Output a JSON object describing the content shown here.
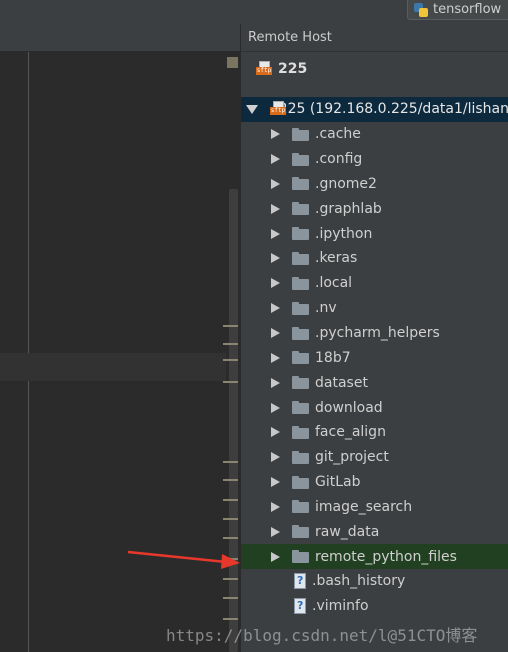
{
  "run_config": {
    "label": "tensorflow",
    "icon": "python-icon"
  },
  "panel": {
    "title": "Remote Host"
  },
  "host_selector": {
    "label": "225",
    "icon": "sftp-icon"
  },
  "tree": {
    "root": {
      "label": "225 (192.168.0.225/data1/lishan",
      "expanded": true
    },
    "folders": [
      ".cache",
      ".config",
      ".gnome2",
      ".graphlab",
      ".ipython",
      ".keras",
      ".local",
      ".nv",
      ".pycharm_helpers",
      "18b7",
      "dataset",
      "download",
      "face_align",
      "git_project",
      "GitLab",
      "image_search",
      "raw_data",
      "remote_python_files"
    ],
    "selected": "remote_python_files",
    "files": [
      ".bash_history",
      ".viminfo"
    ]
  },
  "watermark": "https://blog.csdn.net/l@51CTO博客",
  "colors": {
    "selection": "#214021",
    "root_highlight": "#0d293e",
    "annotation_arrow": "#e8382c"
  }
}
